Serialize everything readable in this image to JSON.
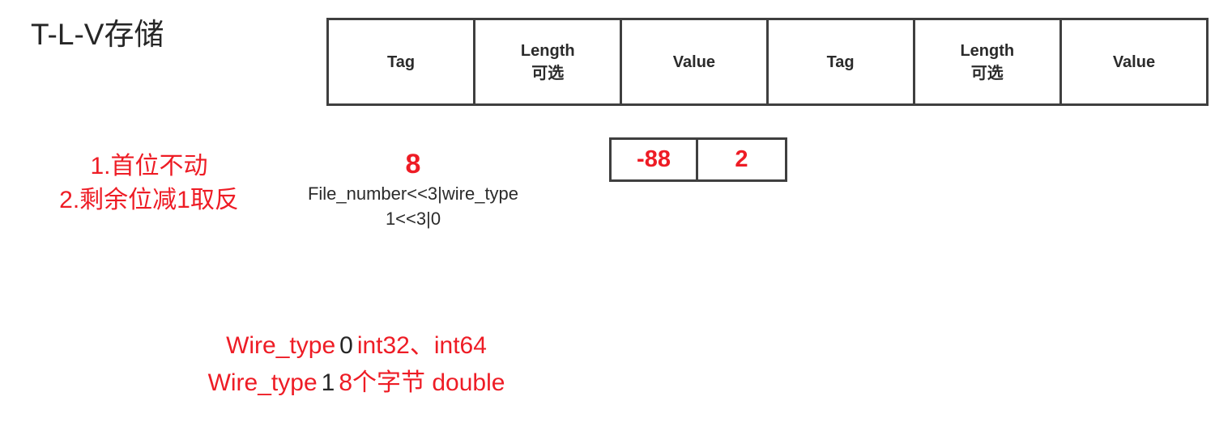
{
  "title": "T-L-V存储",
  "colors": {
    "red": "#ee1c25",
    "dark": "#262626",
    "border": "#3f3f3f"
  },
  "tlv_table": {
    "cells": [
      {
        "label": "Tag",
        "sub": ""
      },
      {
        "label": "Length",
        "sub": "可选"
      },
      {
        "label": "Value",
        "sub": ""
      },
      {
        "label": "Tag",
        "sub": ""
      },
      {
        "label": "Length",
        "sub": "可选"
      },
      {
        "label": "Value",
        "sub": ""
      }
    ]
  },
  "left_notes": {
    "line1": "1.首位不动",
    "line2": "2.剩余位减1取反"
  },
  "tag_example": {
    "number": "8",
    "formula": "File_number<<3|wire_type",
    "computation": "1<<3|0"
  },
  "value_boxes": {
    "cells": [
      "-88",
      "2"
    ]
  },
  "wiretype_legend": {
    "line1": {
      "name": "Wire_type",
      "code": "0",
      "desc": "int32、int64"
    },
    "line2": {
      "name": "Wire_type",
      "code": "1",
      "desc": "8个字节 double"
    }
  }
}
